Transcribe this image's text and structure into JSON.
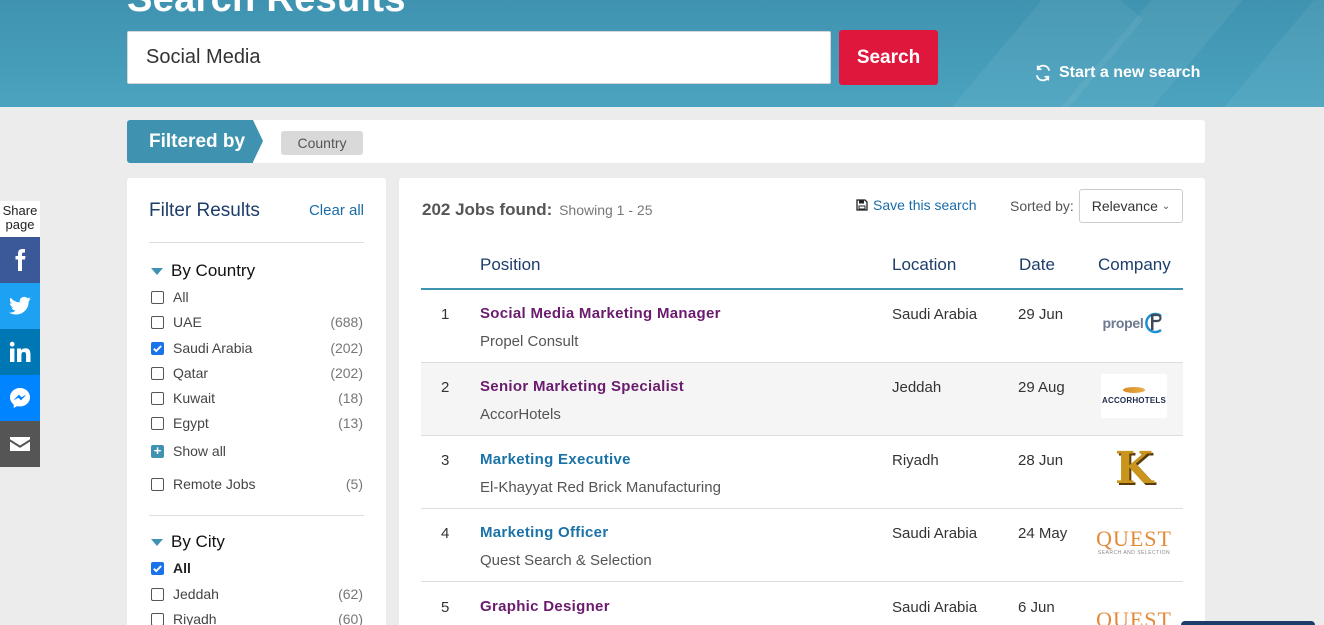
{
  "header": {
    "title": "Search Results",
    "search_value": "Social Media",
    "search_button": "Search",
    "new_search": "Start a new search"
  },
  "filtered": {
    "label": "Filtered by",
    "chips": [
      "Country"
    ]
  },
  "share": {
    "label": "Share page",
    "buttons": [
      {
        "name": "facebook",
        "color": "#3b5998"
      },
      {
        "name": "twitter",
        "color": "#1da1f2"
      },
      {
        "name": "linkedin",
        "color": "#0077b5"
      },
      {
        "name": "messenger",
        "color": "#0084ff"
      },
      {
        "name": "email",
        "color": "#555555"
      }
    ]
  },
  "sidebar": {
    "title": "Filter Results",
    "clear_all": "Clear all",
    "by_country": {
      "title": "By Country",
      "items": [
        {
          "label": "All",
          "count": "",
          "checked": false
        },
        {
          "label": "UAE",
          "count": "(688)",
          "checked": false
        },
        {
          "label": "Saudi Arabia",
          "count": "(202)",
          "checked": true
        },
        {
          "label": "Qatar",
          "count": "(202)",
          "checked": false
        },
        {
          "label": "Kuwait",
          "count": "(18)",
          "checked": false
        },
        {
          "label": "Egypt",
          "count": "(13)",
          "checked": false
        }
      ],
      "show_all": "Show all",
      "remote": {
        "label": "Remote Jobs",
        "count": "(5)",
        "checked": false
      }
    },
    "by_city": {
      "title": "By City",
      "items": [
        {
          "label": "All",
          "count": "",
          "checked": true
        },
        {
          "label": "Jeddah",
          "count": "(62)",
          "checked": false
        },
        {
          "label": "Riyadh",
          "count": "(60)",
          "checked": false
        }
      ]
    }
  },
  "results": {
    "count_text": "202 Jobs found:",
    "showing": "Showing 1 - 25",
    "save_search": "Save this search",
    "sorted_label": "Sorted by:",
    "sorted_value": "Relevance",
    "columns": {
      "position": "Position",
      "location": "Location",
      "date": "Date",
      "company": "Company"
    },
    "jobs": [
      {
        "num": "1",
        "position": "Social Media Marketing Manager",
        "company": "Propel Consult",
        "location": "Saudi Arabia",
        "date": "29 Jun",
        "logo": "propel",
        "visited": true
      },
      {
        "num": "2",
        "position": "Senior Marketing Specialist",
        "company": "AccorHotels",
        "location": "Jeddah",
        "date": "29 Aug",
        "logo": "accor",
        "visited": true
      },
      {
        "num": "3",
        "position": "Marketing Executive",
        "company": "El-Khayyat Red Brick Manufacturing",
        "location": "Riyadh",
        "date": "28 Jun",
        "logo": "k",
        "visited": false
      },
      {
        "num": "4",
        "position": "Marketing Officer",
        "company": "Quest Search & Selection",
        "location": "Saudi Arabia",
        "date": "24 May",
        "logo": "quest",
        "visited": false
      },
      {
        "num": "5",
        "position": "Graphic Designer",
        "company": "",
        "location": "Saudi Arabia",
        "date": "6 Jun",
        "logo": "quest",
        "visited": true
      }
    ],
    "logos": {
      "propel": "propel",
      "accor": "ACCORHOTELS",
      "k": "K",
      "quest_main": "QUEST",
      "quest_sub": "SEARCH AND SELECTION"
    }
  }
}
